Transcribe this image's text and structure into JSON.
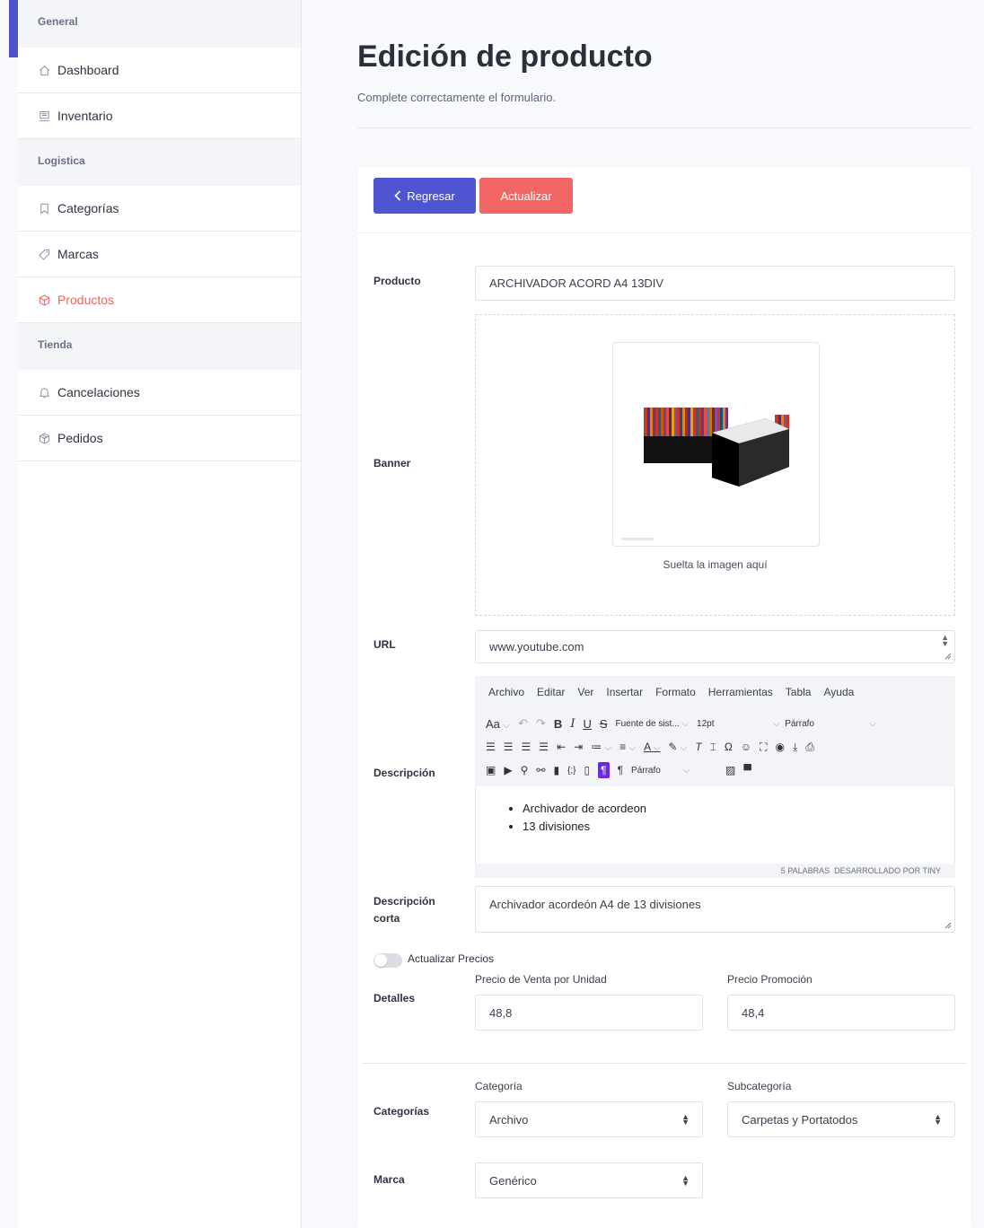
{
  "sidebar": {
    "sections": [
      {
        "label": "General",
        "items": [
          {
            "label": "Dashboard",
            "icon": "home-icon"
          },
          {
            "label": "Inventario",
            "icon": "inventory-icon"
          }
        ]
      },
      {
        "label": "Logistica",
        "items": [
          {
            "label": "Categorías",
            "icon": "bookmark-icon"
          },
          {
            "label": "Marcas",
            "icon": "tag-icon"
          },
          {
            "label": "Productos",
            "icon": "box-icon",
            "active": true
          }
        ]
      },
      {
        "label": "Tienda",
        "items": [
          {
            "label": "Cancelaciones",
            "icon": "bell-icon"
          },
          {
            "label": "Pedidos",
            "icon": "package-icon"
          }
        ]
      }
    ],
    "active_color": "#f0645c"
  },
  "header": {
    "title": "Edición de producto",
    "subtitle": "Complete correctamente el formulario."
  },
  "actions": {
    "back_label": "Regresar",
    "update_label": "Actualizar",
    "back_color": "#4f55d1",
    "update_color": "#f26765"
  },
  "form": {
    "product_label": "Producto",
    "product_value": "ARCHIVADOR ACORD A4 13DIV",
    "banner_label": "Banner",
    "drop_text": "Suelta la imagen aquí",
    "url_label": "URL",
    "url_value": "www.youtube.com",
    "description_label": "Descripción",
    "short_description_label_1": "Descripción",
    "short_description_label_2": "corta",
    "short_description_value": "Archivador acordeón A4 de 13 divisiones",
    "toggle_label": "Actualizar Precios",
    "toggle_on": false,
    "details_label": "Detalles",
    "price_label": "Precio de Venta por Unidad",
    "price_value": "48,8",
    "promo_label": "Precio Promoción",
    "promo_value": "48,4",
    "categories_label": "Categorías",
    "category_label": "Categoría",
    "category_value": "Archivo",
    "subcategory_label": "Subcategoría",
    "subcategory_value": "Carpetas y Portatodos",
    "brand_label": "Marca",
    "brand_value": "Genérico"
  },
  "editor": {
    "menu": [
      "Archivo",
      "Editar",
      "Ver",
      "Insertar",
      "Formato",
      "Herramientas",
      "Tabla",
      "Ayuda"
    ],
    "font_family": "Fuente de sist...",
    "font_size": "12pt",
    "block_format": "Párrafo",
    "block_format_2": "Párrafo",
    "bullets": [
      "Archivador de acordeon",
      "13 divisiones"
    ],
    "status_words": "5 PALABRAS",
    "status_brand": "DESARROLLADO POR TINY"
  }
}
